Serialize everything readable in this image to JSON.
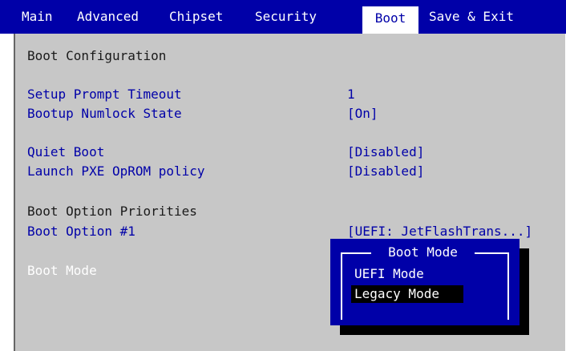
{
  "menubar": {
    "tabs": [
      {
        "label": "Main"
      },
      {
        "label": "Advanced"
      },
      {
        "label": "Chipset"
      },
      {
        "label": "Security"
      },
      {
        "label": "Boot"
      },
      {
        "label": "Save & Exit"
      }
    ],
    "active_tab": "Boot"
  },
  "boot": {
    "section_title": "Boot Configuration",
    "settings": [
      {
        "label": "Setup Prompt Timeout",
        "value": "1"
      },
      {
        "label": "Bootup Numlock State",
        "value": "[On]"
      },
      {
        "label": "Quiet Boot",
        "value": "[Disabled]"
      },
      {
        "label": "Launch PXE OpROM policy",
        "value": "[Disabled]"
      }
    ],
    "priorities_title": "Boot Option Priorities",
    "boot_option_1": {
      "label": "Boot Option #1",
      "value": "[UEFI: JetFlashTrans...]"
    },
    "boot_mode_label": "Boot Mode"
  },
  "popup": {
    "title": "Boot Mode",
    "options": [
      "UEFI Mode",
      "Legacy Mode"
    ],
    "selected": "Legacy Mode"
  },
  "colors": {
    "menubar_bg": "#0000a8",
    "panel_bg": "#c7c7c7",
    "setting_text": "#0000a8",
    "highlight_text": "#ffffff",
    "popup_bg": "#0000a8",
    "selection_bg": "#000000"
  }
}
